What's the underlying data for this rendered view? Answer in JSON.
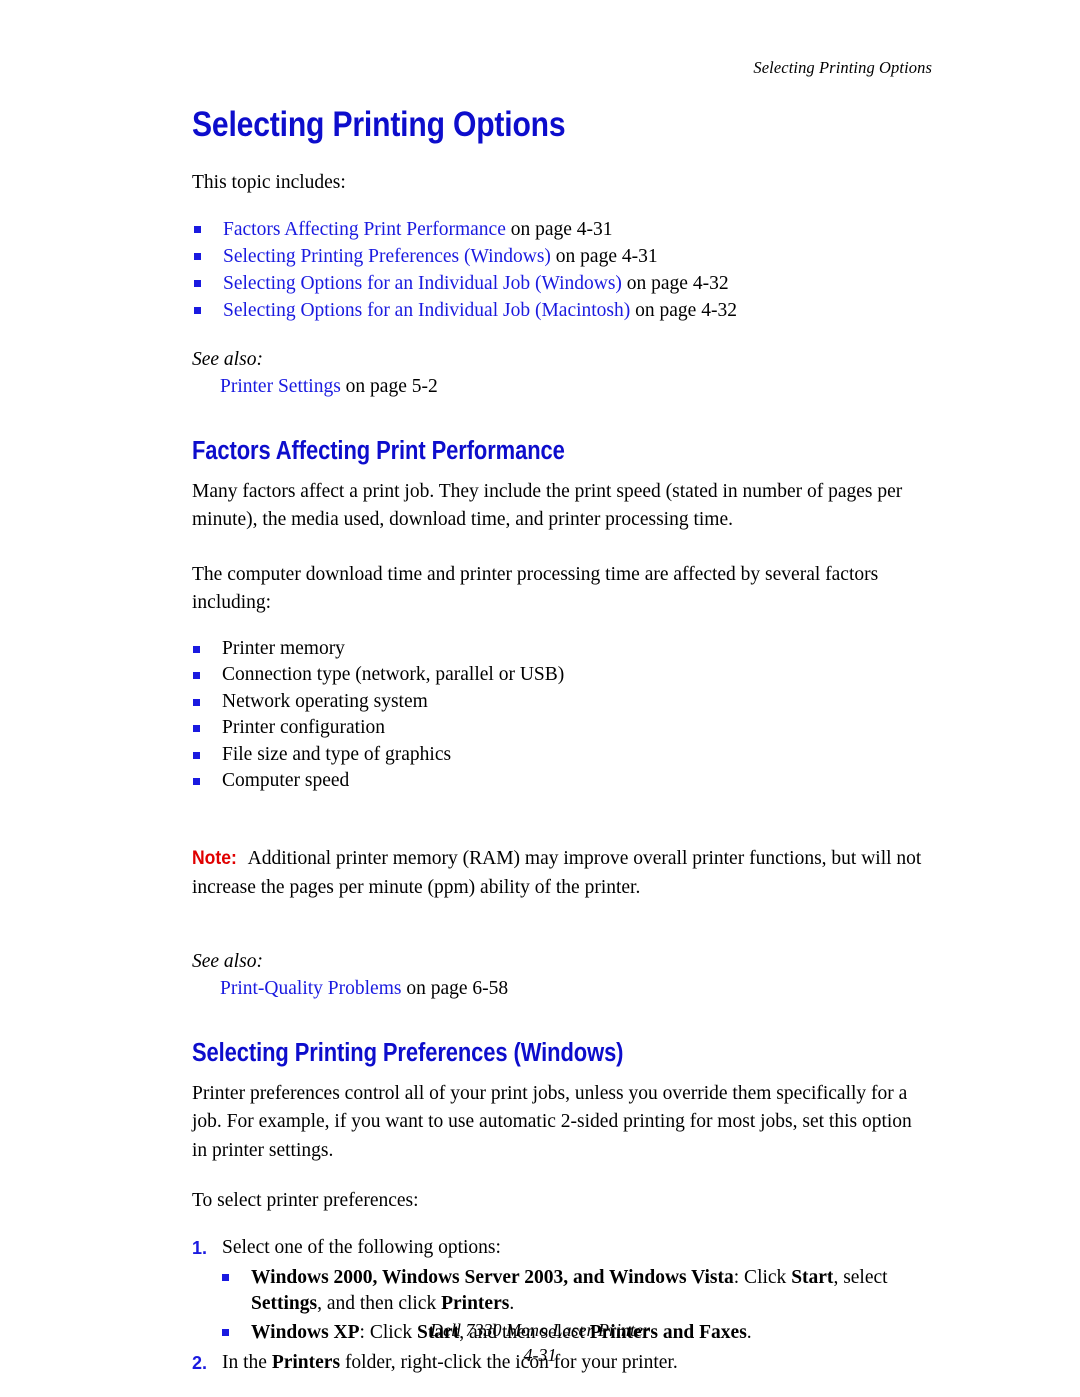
{
  "header": {
    "running_title": "Selecting Printing Options"
  },
  "title": "Selecting Printing Options",
  "intro": {
    "lead": "This topic includes:",
    "links": [
      {
        "title": "Factors Affecting Print Performance",
        "suffix": " on page 4-31"
      },
      {
        "title": "Selecting Printing Preferences (Windows)",
        "suffix": " on page 4-31"
      },
      {
        "title": "Selecting Options for an Individual Job (Windows)",
        "suffix": " on page 4-32"
      },
      {
        "title": "Selecting Options for an Individual Job (Macintosh)",
        "suffix": " on page 4-32"
      }
    ],
    "see_also_label": "See also:",
    "see_also": {
      "title": "Printer Settings",
      "suffix": " on page 5-2"
    }
  },
  "section_factors": {
    "heading": "Factors Affecting Print Performance",
    "para1": "Many factors affect a print job. They include the print speed (stated in number of pages per minute), the media used, download time, and printer processing time.",
    "para2": "The computer download time and printer processing time are affected by several factors including:",
    "bullets": [
      "Printer memory",
      "Connection type (network, parallel or USB)",
      "Network operating system",
      "Printer configuration",
      "File size and type of graphics",
      "Computer speed"
    ],
    "note_label": "Note:",
    "note_text": " Additional printer memory (RAM) may improve overall printer functions, but will not increase the pages per minute (ppm) ability of the printer.",
    "see_also_label": "See also:",
    "see_also": {
      "title": "Print-Quality Problems",
      "suffix": " on page 6-58"
    }
  },
  "section_preferences": {
    "heading": "Selecting Printing Preferences (Windows)",
    "para1": "Printer preferences control all of your print jobs, unless you override them specifically for a job. For example, if you want to use automatic 2-sided printing for most jobs, set this option in printer settings.",
    "para2": "To select printer preferences:",
    "step1": {
      "num": "1.",
      "text": "Select one of the following options:"
    },
    "step1_bullets": [
      {
        "os_bold": "Windows 2000, Windows Server 2003, and Windows Vista",
        "mid1": ": Click ",
        "b1": "Start",
        "mid2": ", select ",
        "b2": "Settings",
        "mid3": ", and then click ",
        "b3": "Printers",
        "tail": "."
      },
      {
        "os_bold": "Windows XP",
        "mid1": ": Click ",
        "b1": "Start",
        "mid2": ", and then select ",
        "b2": "Printers and Faxes",
        "mid3": "",
        "b3": "",
        "tail": "."
      }
    ],
    "step2": {
      "num": "2.",
      "pre": "In the ",
      "bold": "Printers",
      "post": " folder, right-click the icon for your printer."
    }
  },
  "footer": {
    "product": "Dell 7330 Mono Laser Printer",
    "page": "4-31"
  },
  "colors": {
    "link_blue": "#1a1ae0",
    "heading_blue": "#0d0dcc",
    "note_red": "#e00000",
    "text_black": "#000000"
  }
}
